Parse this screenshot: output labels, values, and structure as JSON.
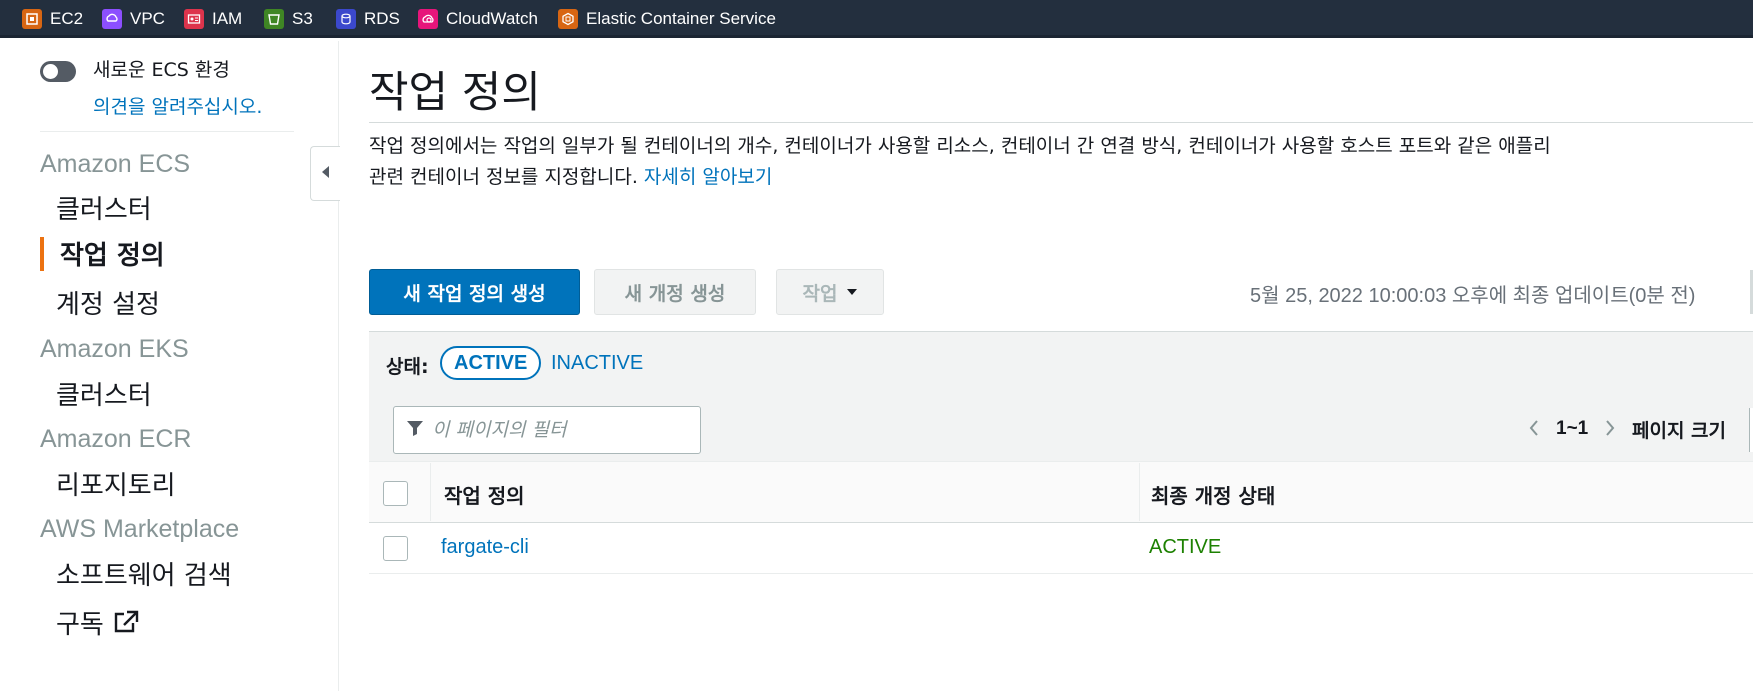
{
  "topnav": {
    "services": [
      {
        "label": "EC2",
        "icon": "ec2-icon",
        "color": "#d86613"
      },
      {
        "label": "VPC",
        "icon": "vpc-icon",
        "color": "#8c4fff"
      },
      {
        "label": "IAM",
        "icon": "iam-icon",
        "color": "#dd344c"
      },
      {
        "label": "S3",
        "icon": "s3-icon",
        "color": "#3f8624"
      },
      {
        "label": "RDS",
        "icon": "rds-icon",
        "color": "#3b48cc"
      },
      {
        "label": "CloudWatch",
        "icon": "cloudwatch-icon",
        "color": "#e7157b"
      },
      {
        "label": "Elastic Container Service",
        "icon": "ecs-icon",
        "color": "#d86613"
      }
    ]
  },
  "sidebar": {
    "toggle_label": "새로운 ECS 환경",
    "feedback_link": "의견을 알려주십시오.",
    "sections": [
      {
        "title": "Amazon ECS",
        "items": [
          "클러스터",
          "작업 정의",
          "계정 설정"
        ]
      },
      {
        "title": "Amazon EKS",
        "items": [
          "클러스터"
        ]
      },
      {
        "title": "Amazon ECR",
        "items": [
          "리포지토리"
        ]
      },
      {
        "title": "AWS Marketplace",
        "items": [
          "소프트웨어 검색",
          "구독"
        ]
      }
    ],
    "active_item": "작업 정의"
  },
  "main": {
    "title": "작업 정의",
    "description_line1": "작업 정의에서는 작업의 일부가 될 컨테이너의 개수, 컨테이너가 사용할 리소스, 컨테이너 간 연결 방식, 컨테이너가 사용할 호스트 포트와 같은 애플리",
    "description_line2": "관련 컨테이너 정보를 지정합니다. ",
    "learn_more": "자세히 알아보기",
    "buttons": {
      "create": "새 작업 정의 생성",
      "new_revision": "새 개정 생성",
      "actions": "작업"
    },
    "last_updated": "5월 25, 2022 10:00:03 오후에 최종 업데이트(0분 전)",
    "status_filter": {
      "label": "상태:",
      "active": "ACTIVE",
      "inactive": "INACTIVE"
    },
    "filter_placeholder": "이 페이지의 필터",
    "pagination": {
      "range": "1~1",
      "page_size_label": "페이지 크기"
    },
    "table": {
      "columns": [
        "작업 정의",
        "최종 개정 상태"
      ],
      "rows": [
        {
          "name": "fargate-cli",
          "status": "ACTIVE"
        }
      ]
    }
  }
}
